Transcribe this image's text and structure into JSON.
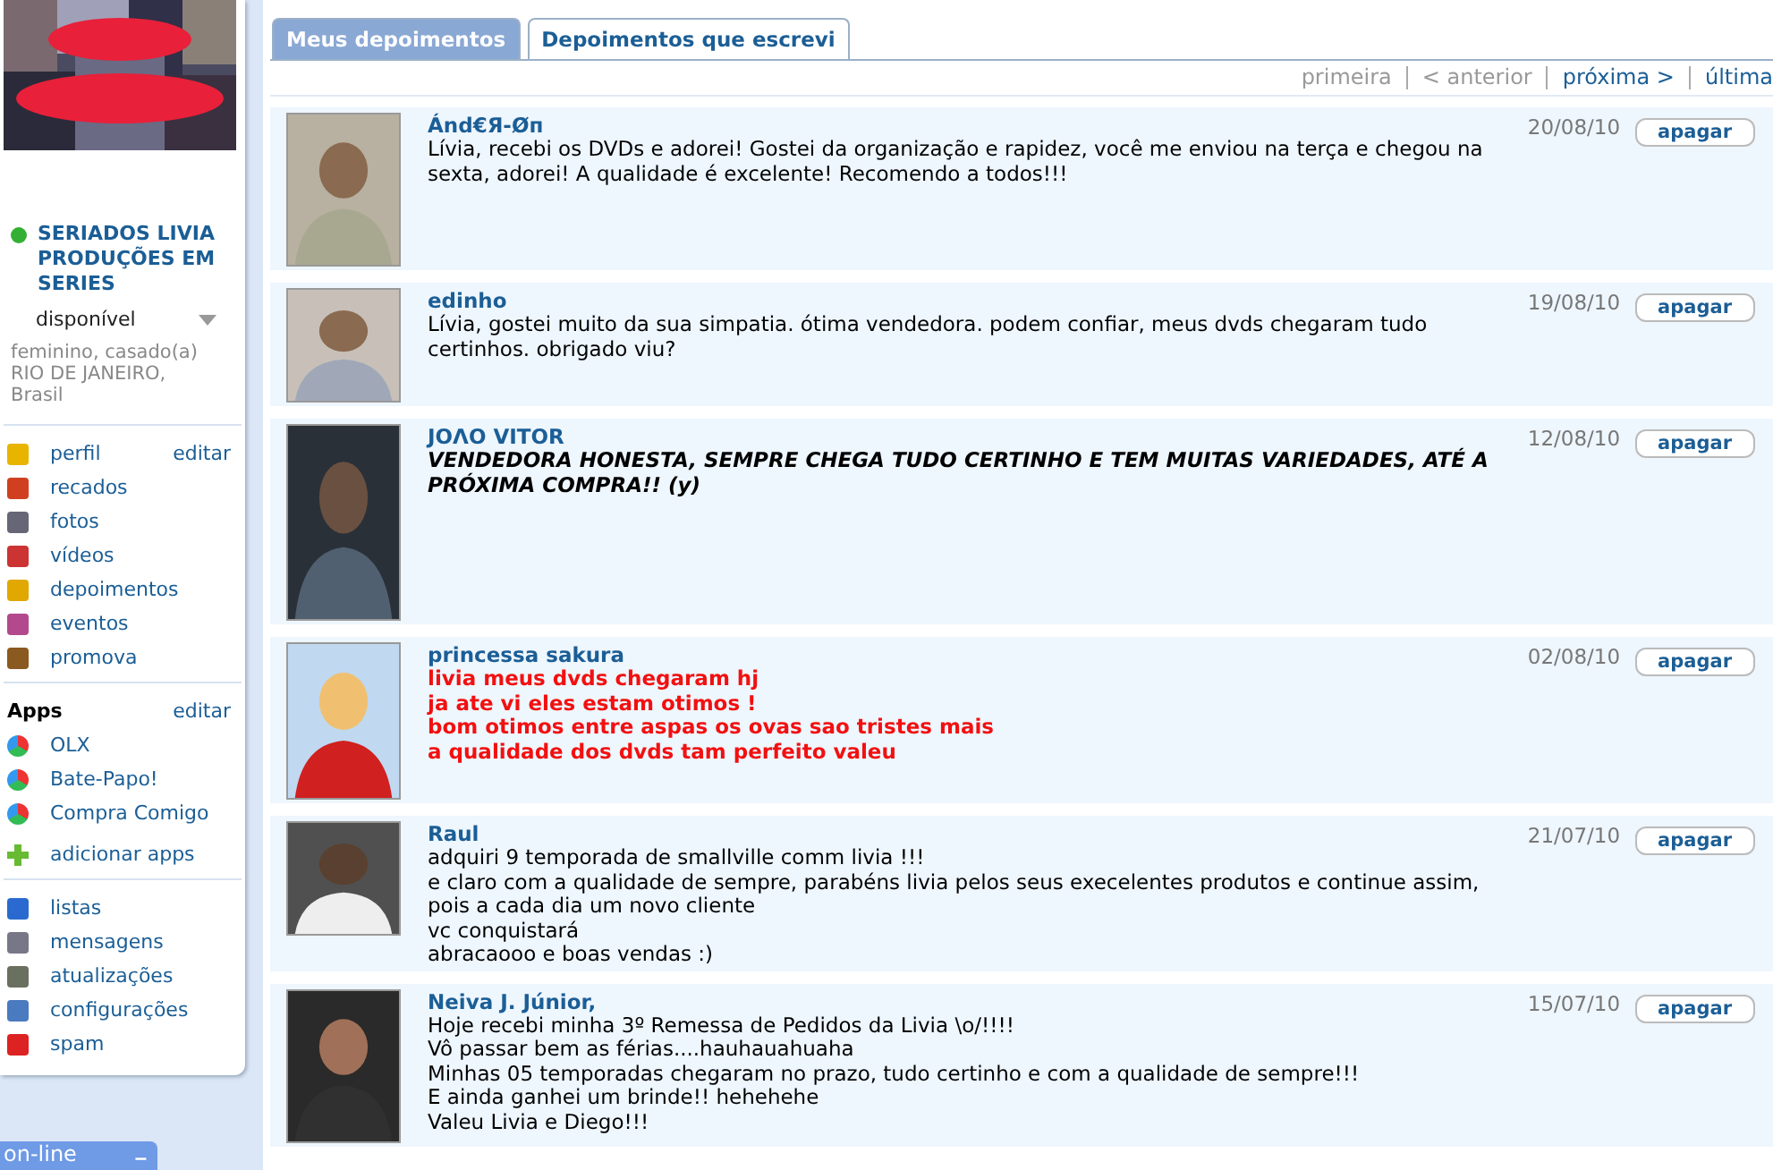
{
  "profile": {
    "name": "SERIADOS LIVIA PRODUÇÕES EM SERIES",
    "online": true,
    "status": "disponível",
    "info": [
      "feminino, casado(a)",
      "RIO DE JANEIRO,",
      "Brasil"
    ]
  },
  "nav": [
    {
      "label": "perfil",
      "action": "editar"
    },
    {
      "label": "recados"
    },
    {
      "label": "fotos"
    },
    {
      "label": "vídeos"
    },
    {
      "label": "depoimentos"
    },
    {
      "label": "eventos"
    },
    {
      "label": "promova"
    }
  ],
  "apps": {
    "title": "Apps",
    "action": "editar",
    "items": [
      {
        "label": "OLX",
        "kind": "app"
      },
      {
        "label": "Bate-Papo!",
        "kind": "app"
      },
      {
        "label": "Compra Comigo",
        "kind": "app"
      },
      {
        "label": "adicionar apps",
        "kind": "add"
      }
    ]
  },
  "tools": [
    {
      "label": "listas"
    },
    {
      "label": "mensagens"
    },
    {
      "label": "atualizações"
    },
    {
      "label": "configurações"
    },
    {
      "label": "spam"
    }
  ],
  "chat_bar": {
    "label": "on-line",
    "button": "–"
  },
  "tabs": [
    {
      "label": "Meus depoimentos",
      "selected": true
    },
    {
      "label": "Depoimentos que escrevi",
      "selected": false
    }
  ],
  "pagination": [
    {
      "label": "primeira",
      "disabled": true
    },
    {
      "label": "< anterior",
      "disabled": true
    },
    {
      "label": "próxima >",
      "disabled": false
    },
    {
      "label": "última",
      "disabled": false
    }
  ],
  "testimonials": [
    {
      "author": "Ánd€Я-Øп",
      "date": "20/08/10",
      "kind": "plain",
      "lines": [
        "Lívia, recebi os DVDs e adorei! Gostei da organização e rapidez, você me enviou na terça e chegou na sexta, adorei! A qualidade é excelente! Recomendo a todos!!!"
      ],
      "action": "apagar"
    },
    {
      "author": "edinho",
      "date": "19/08/10",
      "kind": "plain",
      "lines": [
        "Lívia, gostei muito da sua simpatia. ótima vendedora. podem confiar, meus dvds chegaram tudo certinhos. obrigado viu?"
      ],
      "action": "apagar"
    },
    {
      "author": "JOΛO VITOR",
      "date": "12/08/10",
      "kind": "emphatic",
      "lines": [
        "VENDEDORA HONESTA, SEMPRE CHEGA TUDO CERTINHO E TEM MUITAS VARIEDADES, ATÉ A PRÓXIMA COMPRA!! (y)"
      ],
      "action": "apagar"
    },
    {
      "author": "princessa sakura",
      "date": "02/08/10",
      "kind": "shout",
      "lines": [
        "livia meus dvds chegaram hj",
        "ja ate vi eles estam otimos !",
        "bom otimos entre aspas os ovas sao tristes mais",
        "a qualidade dos dvds tam perfeito valeu"
      ],
      "action": "apagar"
    },
    {
      "author": "Raul",
      "date": "21/07/10",
      "kind": "plain",
      "lines": [
        "adquiri 9 temporada de smallville comm livia !!!",
        "e claro com a qualidade de sempre, parabéns livia pelos seus execelentes produtos e continue assim,",
        "pois a cada dia um novo cliente",
        "vc conquistará",
        "abracaooo e boas vendas :)"
      ],
      "action": "apagar"
    },
    {
      "author": "Neiva J. Júnior,",
      "date": "15/07/10",
      "kind": "plain",
      "lines": [
        "Hoje recebi minha 3º Remessa de Pedidos da Livia \\o/!!!!",
        "Vô passar bem as férias....hauhauahuaha",
        "Minhas 05 temporadas chegaram no prazo, tudo certinho e com a qualidade de sempre!!!",
        "E ainda ganhei um brinde!! hehehehe",
        "Valeu Livia e Diego!!!"
      ],
      "action": "apagar"
    }
  ]
}
